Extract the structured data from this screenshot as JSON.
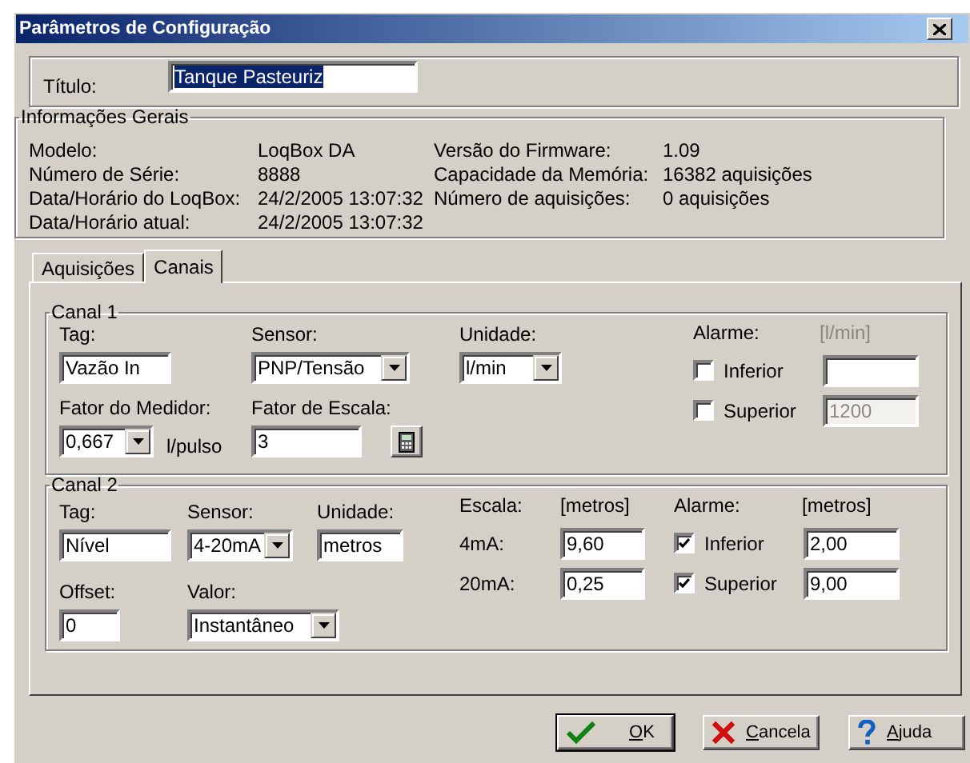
{
  "window": {
    "title": "Parâmetros de Configuração"
  },
  "title_field": {
    "label": "Título:",
    "value": "Tanque Pasteuriz",
    "selected": true
  },
  "general_info": {
    "legend": "Informações Gerais",
    "left": [
      {
        "label": "Modelo:",
        "value": "LoqBox DA"
      },
      {
        "label": "Número de Série:",
        "value": "8888"
      },
      {
        "label": "Data/Horário do LoqBox:",
        "value": "24/2/2005 13:07:32"
      },
      {
        "label": "Data/Horário atual:",
        "value": "24/2/2005 13:07:32"
      }
    ],
    "right": [
      {
        "label": "Versão do Firmware:",
        "value": "1.09"
      },
      {
        "label": "Capacidade da Memória:",
        "value": "16382 aquisições"
      },
      {
        "label": "Número de aquisições:",
        "value": "0 aquisições"
      }
    ]
  },
  "tabs": [
    {
      "label": "Aquisições",
      "selected": false
    },
    {
      "label": "Canais",
      "selected": true
    }
  ],
  "channel_1": {
    "legend": "Canal 1",
    "tag": {
      "label": "Tag:",
      "value": "Vazão In",
      "kind": "text"
    },
    "sensor": {
      "label": "Sensor:",
      "value": "PNP/Tensão",
      "kind": "select"
    },
    "unit": {
      "label": "Unidade:",
      "value": "l/min",
      "kind": "select"
    },
    "meter_factor": {
      "label": "Fator do Medidor:",
      "value": "0,667",
      "kind": "select",
      "suffix": "l/pulso"
    },
    "scale_factor": {
      "label": "Fator de Escala:",
      "value": "3",
      "kind": "text"
    },
    "alarm": {
      "label": "Alarme:",
      "unit": "[l/min]",
      "unit_disabled": true,
      "items": [
        {
          "label": "Inferior",
          "checked": false,
          "disabled": false
        },
        {
          "label": "Superior",
          "checked": false,
          "value": "1200",
          "disabled": true
        }
      ]
    }
  },
  "channel_2": {
    "legend": "Canal 2",
    "tag": {
      "label": "Tag:",
      "value": "Nível",
      "kind": "text"
    },
    "sensor": {
      "label": "Sensor:",
      "value": "4-20mA",
      "kind": "select"
    },
    "unit": {
      "label": "Unidade:",
      "value": "metros",
      "kind": "text"
    },
    "offset": {
      "label": "Offset:",
      "value": "0",
      "kind": "text"
    },
    "reading": {
      "label": "Valor:",
      "value": "Instantâneo",
      "kind": "select"
    },
    "scale": {
      "label": "Escala:",
      "unit": "[metros]",
      "rows": [
        {
          "label": "4mA:",
          "value": "9,60"
        },
        {
          "label": "20mA:",
          "value": "0,25"
        }
      ]
    },
    "alarm": {
      "label": "Alarme:",
      "unit": "[metros]",
      "unit_disabled": false,
      "items": [
        {
          "label": "Inferior",
          "checked": true,
          "value": "2,00",
          "disabled": false
        },
        {
          "label": "Superior",
          "checked": true,
          "value": "9,00",
          "disabled": false
        }
      ]
    }
  },
  "buttons": [
    {
      "label": "OK",
      "kind": "ok",
      "first_letter_underlined": true
    },
    {
      "label": "Cancela",
      "kind": "cancel",
      "first_letter_underlined": true
    },
    {
      "label": "Ajuda",
      "kind": "help",
      "first_letter_underlined": true
    }
  ]
}
